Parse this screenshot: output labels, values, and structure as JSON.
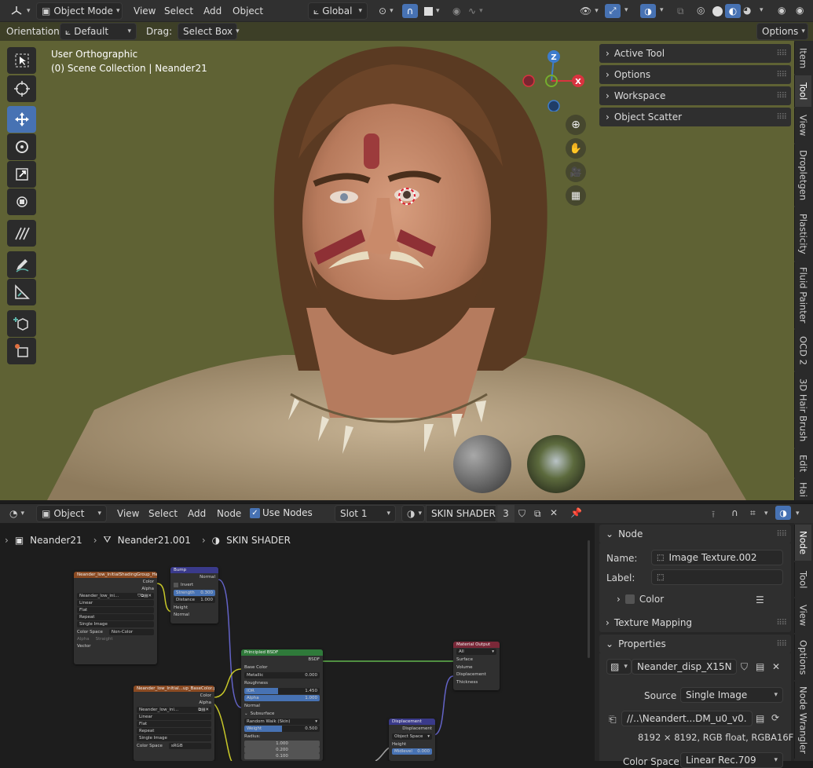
{
  "viewport_header": {
    "mode": "Object Mode",
    "menu": [
      "View",
      "Select",
      "Add",
      "Object"
    ],
    "transform_orientation": "Global"
  },
  "tool_settings": {
    "orientation_label": "Orientation:",
    "orientation_value": "Default",
    "drag_label": "Drag:",
    "drag_value": "Select Box",
    "options": "Options"
  },
  "viewport": {
    "view_name": "User Orthographic",
    "collection": "(0) Scene Collection | Neander21",
    "gizmo_axes": [
      "Z",
      "X"
    ]
  },
  "npanel": {
    "rows": [
      "Active Tool",
      "Options",
      "Workspace",
      "Object Scatter"
    ],
    "tabs": [
      "Item",
      "Tool",
      "View",
      "Dropletgen",
      "Plasticity",
      "Fluid Painter",
      "OCD 2",
      "3D Hair Brush",
      "Edit",
      "Hai"
    ]
  },
  "node_header": {
    "editor": "Object",
    "menu": [
      "View",
      "Select",
      "Add",
      "Node"
    ],
    "use_nodes": "Use Nodes",
    "slot": "Slot 1",
    "material": "SKIN SHADER",
    "users": "3"
  },
  "breadcrumb": [
    "Neander21",
    "Neander21.001",
    "SKIN SHADER"
  ],
  "node_sidebar": {
    "section_node": "Node",
    "name_label": "Name:",
    "name_value": "Image Texture.002",
    "label_label": "Label:",
    "label_value": "",
    "color_label": "Color",
    "texture_mapping": "Texture Mapping",
    "properties": "Properties",
    "image_name": "Neander_disp_X15Ne...",
    "source_label": "Source",
    "source_value": "Single Image",
    "filepath": "//..\\Neandert...DM_u0_v0.exr",
    "image_info": "8192 × 8192,  RGB float, RGBA16F",
    "color_space_label": "Color Space",
    "color_space_value": "Linear Rec.709",
    "tabs": [
      "Node",
      "Tool",
      "View",
      "Options",
      "Node Wrangler"
    ]
  },
  "nodes": {
    "tex1": {
      "title": "Neander_low_InitialShadingGroup_Heig...",
      "out1": "Color",
      "out2": "Alpha",
      "img": "Neander_low_ini...",
      "opts": [
        "Linear",
        "Flat",
        "Repeat",
        "Single Image"
      ],
      "cs_label": "Color Space",
      "cs_value": "Non-Color",
      "alpha_label": "Alpha",
      "alpha_value": "Straight",
      "vector": "Vector"
    },
    "bump": {
      "title": "Bump",
      "out": "Normal",
      "invert": "Invert",
      "strength_label": "Strength",
      "strength_value": "0.300",
      "distance_label": "Distance",
      "distance_value": "1.000",
      "height": "Height",
      "normal": "Normal"
    },
    "tex2": {
      "title": "Neander_low_Initial...up_BaseColor.png",
      "out1": "Color",
      "out2": "Alpha",
      "img": "Neander_low_ini...",
      "opts": [
        "Linear",
        "Flat",
        "Repeat",
        "Single Image"
      ],
      "cs_label": "Color Space",
      "cs_value": "sRGB"
    },
    "bsdf": {
      "title": "Principled BSDF",
      "out": "BSDF",
      "base_color": "Base Color",
      "metallic_label": "Metallic",
      "metallic_value": "0.000",
      "roughness": "Roughness",
      "ior_label": "IOR",
      "ior_value": "1.450",
      "alpha_label": "Alpha",
      "alpha_value": "1.000",
      "normal": "Normal",
      "subsurface": "Subsurface",
      "method": "Random Walk (Skin)",
      "weight_label": "Weight",
      "weight_value": "0.500",
      "radius": "Radius:",
      "radius_values": [
        "1.000",
        "0.200",
        "0.100"
      ]
    },
    "output": {
      "title": "Material Output",
      "target": "All",
      "sockets": [
        "Surface",
        "Volume",
        "Displacement",
        "Thickness"
      ]
    },
    "disp": {
      "title": "Displacement",
      "out": "Displacement",
      "space": "Object Space",
      "height": "Height",
      "midlevel_label": "Midlevel",
      "midlevel_value": "0.000"
    }
  },
  "colors": {
    "viewport_bg": "#5f6234",
    "active_blue": "#4772b3",
    "x_axis": "#d9333f",
    "y_axis": "#75ad2e",
    "z_axis": "#3d7ccc"
  }
}
